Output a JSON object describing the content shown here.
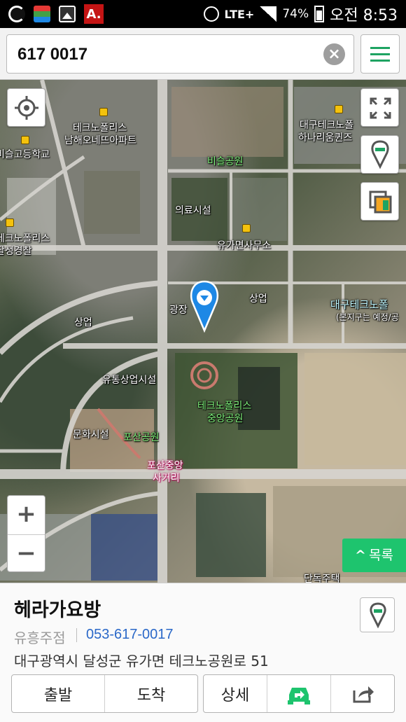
{
  "status_bar": {
    "icons": [
      "gesture-icon",
      "color-bars-icon",
      "gallery-icon",
      "acrobat-icon"
    ],
    "network": "LTE+",
    "battery": "74%",
    "time": "오전 8:53"
  },
  "search": {
    "value": "617 0017",
    "clear_icon": "clear-icon",
    "menu_icon": "hamburger-menu-icon",
    "accent": "#1ea362"
  },
  "map": {
    "labels": {
      "techno_namhae": "테크노폴리스",
      "namhae_apt": "남해오네뜨아파트",
      "school": "비슬고등학교",
      "techno_left": "테크노폴리스",
      "police": "달성경찰",
      "daegu_techno": "대구테크노폴",
      "hanaroom": "하나리움퀸즈",
      "bisl_park": "비슬공원",
      "medical": "의료시설",
      "office": "유가면사무소",
      "commercial_right": "상업",
      "plaza": "광장",
      "commercial_left": "상업",
      "cyan_1": "대구테크노폴",
      "cyan_2": "(본지구는 예정/공",
      "distribution": "유통상업시설",
      "central_park_1": "테크노폴리스",
      "central_park_2": "중앙공원",
      "culture": "문화시설",
      "posan_park": "포산공원",
      "intersection_1": "포산중앙",
      "intersection_2": "사거리",
      "detached": "단독주택"
    },
    "list_button": "목록",
    "zoom_in": "+",
    "zoom_out": "−"
  },
  "place": {
    "name": "헤라가요방",
    "branch": "유흥주점",
    "phone": "053-617-0017",
    "address": "대구광역시 달성군 유가면 테크노공원로 51"
  },
  "actions": {
    "depart": "출발",
    "arrive": "도착",
    "detail": "상세",
    "navi_icon": "car-navigation-icon",
    "share_icon": "share-icon"
  },
  "colors": {
    "pin_blue": "#1e88e5",
    "green_button": "#1ec46e",
    "phone_link": "#2a68c8"
  }
}
